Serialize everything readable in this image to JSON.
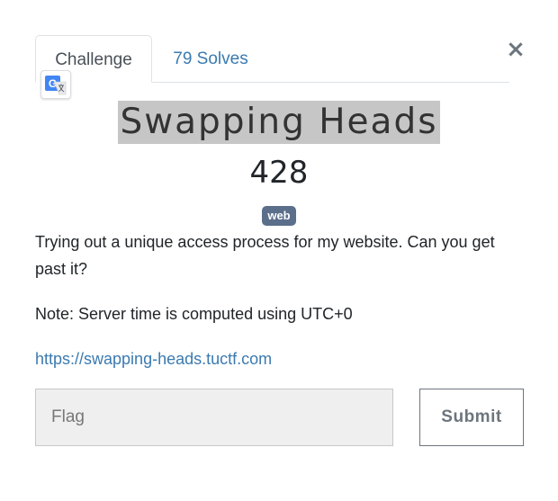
{
  "tabs": {
    "challenge_label": "Challenge",
    "solves_label": "79 Solves"
  },
  "close_label": "×",
  "challenge": {
    "name": "Swapping Heads",
    "points": "428",
    "category": "web",
    "description": "Trying out a unique access process for my website. Can you get past it?",
    "note": "Note: Server time is computed using UTC+0",
    "link": "https://swapping-heads.tuctf.com"
  },
  "flag_form": {
    "value": "",
    "placeholder": "Flag",
    "submit_label": "Submit"
  },
  "icons": {
    "translate": "google-translate-icon",
    "close": "close-icon"
  },
  "colors": {
    "link": "#3b7ab0",
    "badge_bg": "#5b6f8a",
    "title_highlight": "#c6c6c6",
    "input_bg": "#efefef"
  }
}
